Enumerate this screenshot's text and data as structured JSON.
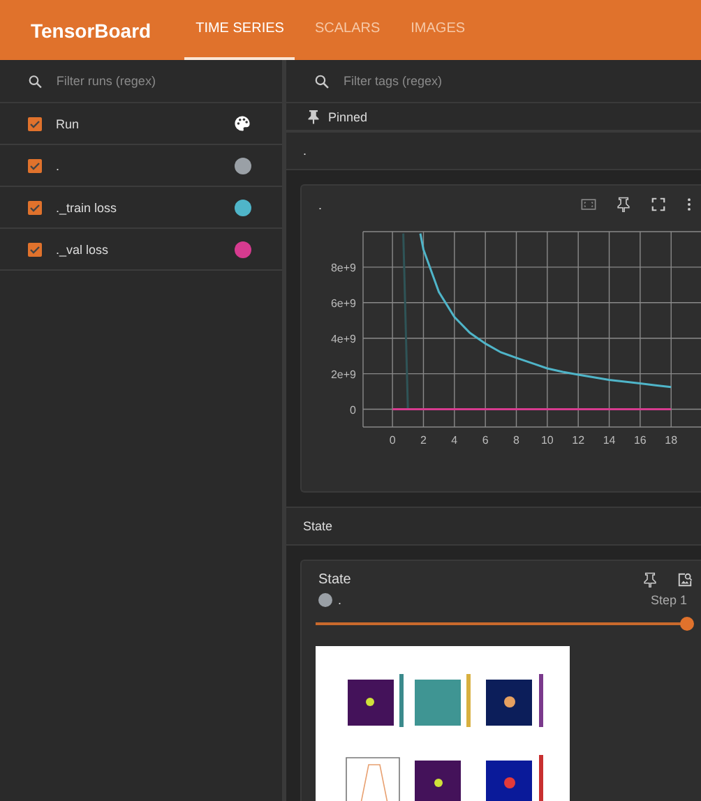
{
  "app": {
    "title": "TensorBoard"
  },
  "tabs": [
    {
      "label": "TIME SERIES",
      "selected": true
    },
    {
      "label": "SCALARS",
      "selected": false
    },
    {
      "label": "IMAGES",
      "selected": false
    }
  ],
  "runs_panel": {
    "filter": {
      "placeholder": "Filter runs (regex)"
    },
    "header": {
      "label": "Run",
      "checked": true
    },
    "runs": [
      {
        "name": ".",
        "checked": true,
        "color": "#9aa0a6"
      },
      {
        "name": "._train loss",
        "checked": true,
        "color": "#4fb5c9"
      },
      {
        "name": "._val loss",
        "checked": true,
        "color": "#d63b8f"
      }
    ]
  },
  "tags_panel": {
    "filter": {
      "placeholder": "Filter tags (regex)"
    },
    "pinned_label": "Pinned",
    "scalar_group": {
      "title": ".",
      "card": {
        "title": ".",
        "chart_data": {
          "type": "line",
          "grid": true,
          "x": [
            0,
            0.7,
            1,
            1.8,
            2,
            3,
            4,
            5,
            6,
            7,
            8,
            9,
            10,
            11,
            12,
            13,
            14,
            15,
            16,
            17,
            18
          ],
          "xlim": [
            -1.9,
            20.2
          ],
          "ylim": [
            -1000000000,
            10000000000
          ],
          "xticks": [
            0,
            2,
            4,
            6,
            8,
            10,
            12,
            14,
            16,
            18
          ],
          "yticks": [
            0,
            {
              "value": 2000000000,
              "label": "2e+9"
            },
            {
              "value": 4000000000,
              "label": "4e+9"
            },
            {
              "value": 6000000000,
              "label": "6e+9"
            },
            {
              "value": 8000000000,
              "label": "8e+9"
            }
          ],
          "series": [
            {
              "color": "#2f5457",
              "values": [
                null,
                9900000000,
                0,
                null,
                null,
                null,
                null,
                null,
                null,
                null,
                null,
                null,
                null,
                null,
                null,
                null,
                null,
                null,
                null,
                null,
                null
              ]
            },
            {
              "color": "#4fb5c9",
              "values": [
                null,
                null,
                null,
                9900000000,
                9000000000,
                6600000000,
                5200000000,
                4300000000,
                3700000000,
                3200000000,
                2900000000,
                2600000000,
                2300000000,
                2100000000,
                1950000000,
                1800000000,
                1650000000,
                1550000000,
                1450000000,
                1350000000,
                1250000000
              ]
            },
            {
              "color": "#d63b8f",
              "values": [
                0,
                0,
                0,
                0,
                0,
                0,
                0,
                0,
                0,
                0,
                0,
                0,
                0,
                0,
                0,
                0,
                0,
                0,
                0,
                0,
                0
              ]
            }
          ]
        }
      }
    },
    "image_group": {
      "title": "State",
      "card": {
        "title": "State",
        "run": {
          "name": ".",
          "color": "#9aa0a6"
        },
        "step": "Step 1",
        "level": 1
      }
    }
  }
}
